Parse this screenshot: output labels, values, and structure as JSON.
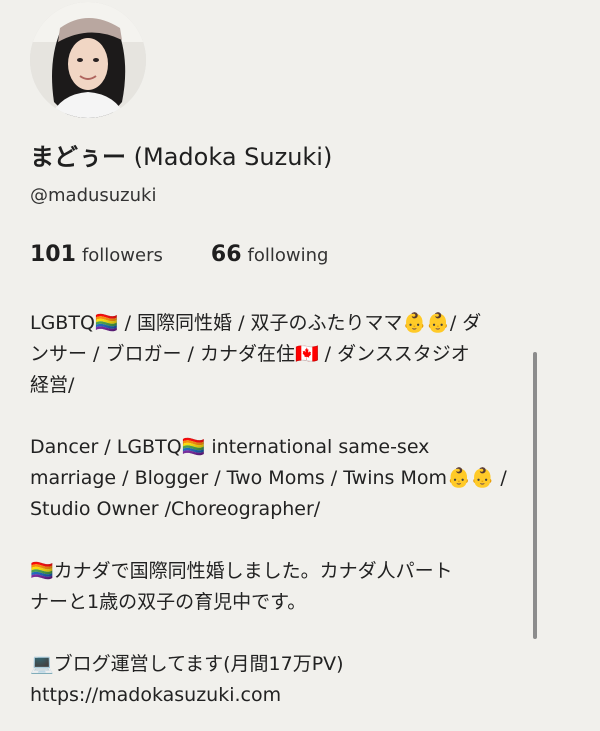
{
  "profile": {
    "display_name_jp": "まどぅー",
    "display_name_en": "(Madoka Suzuki)",
    "handle": "@madusuzuki",
    "followers_count": "101",
    "followers_label": "followers",
    "following_count": "66",
    "following_label": "following"
  },
  "bio": {
    "p1_l1": "LGBTQ🏳️‍🌈 / 国際同性婚 / 双子のふたりママ👶👶/ ダ",
    "p1_l2": "ンサー / ブロガー / カナダ在住🇨🇦 / ダンススタジオ",
    "p1_l3": "経営/",
    "p2_l1": "Dancer / LGBTQ🏳️‍🌈 international same-sex",
    "p2_l2": "marriage / Blogger / Two Moms / Twins Mom👶👶 /",
    "p2_l3": "Studio Owner /Choreographer/",
    "p3_l1": "🏳️‍🌈カナダで国際同性婚しました。カナダ人パート",
    "p3_l2": "ナーと1歳の双子の育児中です。",
    "p4_l1": "💻ブログ運営してます(月間17万PV)",
    "p4_l2": "https://madokasuzuki.com"
  },
  "colors": {
    "background": "#f1f0ec",
    "text": "#222222",
    "scrollbar": "#8c8c8c"
  },
  "icons": {
    "avatar": "profile-photo"
  }
}
